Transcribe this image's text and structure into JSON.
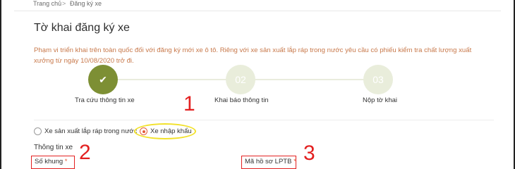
{
  "breadcrumb": {
    "home": "Trang chủ",
    "separator": ">",
    "current": "Đăng ký xe"
  },
  "page": {
    "title": "Tờ khai đăng ký xe",
    "notice": "Phạm vi triển khai trên toàn quốc đối với đăng ký mới xe ô tô. Riêng với xe sản xuất lắp ráp trong nước yêu cầu có phiếu kiểm tra chất lượng xuất xưởng từ ngày 10/08/2020 trở đi."
  },
  "steps": [
    {
      "marker": "✔",
      "label": "Tra cứu thông tin xe",
      "state": "done"
    },
    {
      "marker": "02",
      "label": "Khai báo thông tin",
      "state": "pending"
    },
    {
      "marker": "03",
      "label": "Nộp tờ khai",
      "state": "pending"
    }
  ],
  "vehicle_origin": {
    "options": [
      {
        "label": "Xe sản xuất lắp ráp trong nước",
        "checked": false
      },
      {
        "label": "Xe nhập khẩu",
        "checked": true
      }
    ]
  },
  "vehicle_info": {
    "section_title": "Thông tin xe",
    "fields": [
      {
        "label": "Số khung",
        "required_mark": "*"
      },
      {
        "label": "Mã hồ sơ LPTB",
        "required_mark": "*"
      }
    ]
  },
  "annotations": [
    "1",
    "2",
    "3"
  ],
  "colors": {
    "accent_green": "#7d8f34",
    "step_pending": "#e9eddb",
    "notice_orange": "#c8794b",
    "radio_selected": "#e35b3a",
    "annotation_red": "#e32020",
    "highlight_yellow": "#f2e12a"
  }
}
